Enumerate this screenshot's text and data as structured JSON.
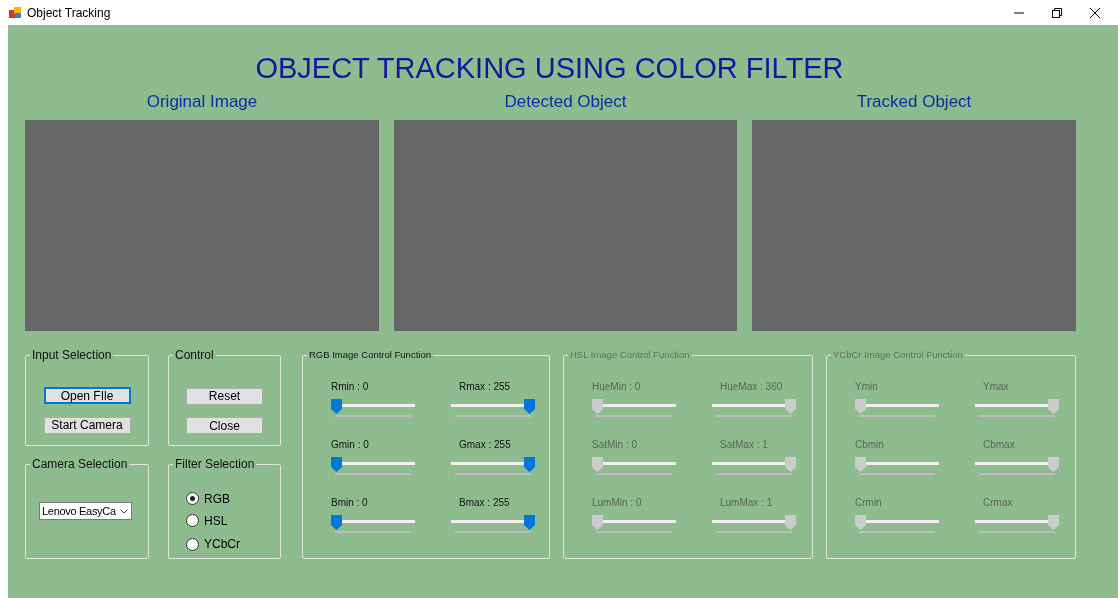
{
  "window": {
    "title": "Object Tracking"
  },
  "heading": "OBJECT TRACKING USING COLOR FILTER",
  "image_panels": [
    {
      "label": "Original Image"
    },
    {
      "label": "Detected Object"
    },
    {
      "label": "Tracked Object"
    }
  ],
  "input_selection": {
    "title": "Input Selection",
    "buttons": [
      {
        "label": "Open FIle",
        "focused": true
      },
      {
        "label": "Start Camera",
        "focused": false
      }
    ]
  },
  "control": {
    "title": "Control",
    "buttons": [
      {
        "label": "Reset",
        "focused": false
      },
      {
        "label": "Close",
        "focused": false
      }
    ]
  },
  "camera_selection": {
    "title": "Camera Selection",
    "dropdown": {
      "value": "Lenovo EasyCa"
    }
  },
  "filter_selection": {
    "title": "Filter Selection",
    "options": [
      {
        "label": "RGB",
        "selected": true
      },
      {
        "label": "HSL",
        "selected": false
      },
      {
        "label": "YCbCr",
        "selected": false
      }
    ]
  },
  "filter_groups": [
    {
      "title": "RGB Image Control Function",
      "disabled": false,
      "sliders": [
        {
          "label": "Rmin : 0",
          "level": 0
        },
        {
          "label": "Rmax : 255",
          "level": 1
        },
        {
          "label": "Gmin : 0",
          "level": 0
        },
        {
          "label": "Gmax : 255",
          "level": 1
        },
        {
          "label": "Bmin : 0",
          "level": 0
        },
        {
          "label": "Bmax : 255",
          "level": 1
        }
      ]
    },
    {
      "title": "HSL Image Control Function",
      "disabled": true,
      "sliders": [
        {
          "label": "HueMin : 0",
          "level": 0
        },
        {
          "label": "HueMax : 360",
          "level": 1
        },
        {
          "label": "SatMin : 0",
          "level": 0
        },
        {
          "label": "SatMax : 1",
          "level": 1
        },
        {
          "label": "LumMin : 0",
          "level": 0
        },
        {
          "label": "LumMax : 1",
          "level": 1
        }
      ]
    },
    {
      "title": "YCbCr Image Control Function",
      "disabled": true,
      "sliders": [
        {
          "label": "Ymin",
          "level": 0
        },
        {
          "label": "Ymax",
          "level": 1
        },
        {
          "label": "Cbmin",
          "level": 0
        },
        {
          "label": "Cbmax",
          "level": 1
        },
        {
          "label": "Crmin",
          "level": 0
        },
        {
          "label": "Crmax",
          "level": 1
        }
      ]
    }
  ]
}
